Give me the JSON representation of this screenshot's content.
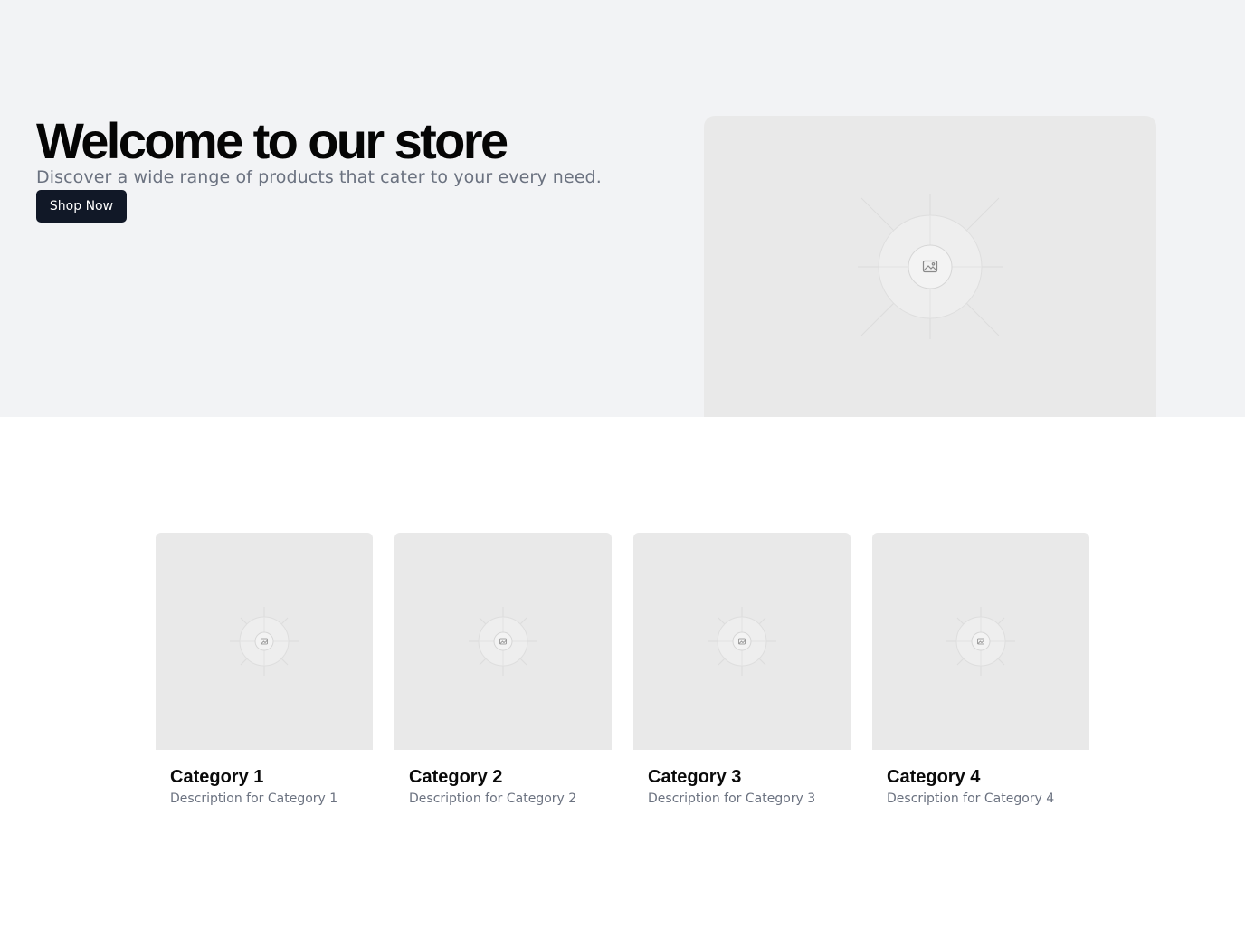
{
  "hero": {
    "title": "Welcome to our store",
    "subtitle": "Discover a wide range of products that cater to your every need.",
    "button_label": "Shop Now",
    "image_icon": "image-placeholder-icon"
  },
  "categories": [
    {
      "title": "Category 1",
      "description": "Description for Category 1",
      "image_icon": "image-placeholder-icon"
    },
    {
      "title": "Category 2",
      "description": "Description for Category 2",
      "image_icon": "image-placeholder-icon"
    },
    {
      "title": "Category 3",
      "description": "Description for Category 3",
      "image_icon": "image-placeholder-icon"
    },
    {
      "title": "Category 4",
      "description": "Description for Category 4",
      "image_icon": "image-placeholder-icon"
    }
  ],
  "colors": {
    "hero_background": "#f2f3f5",
    "button_background": "#111827",
    "placeholder_background": "#e9e9e9",
    "muted_text": "#6b7280"
  }
}
